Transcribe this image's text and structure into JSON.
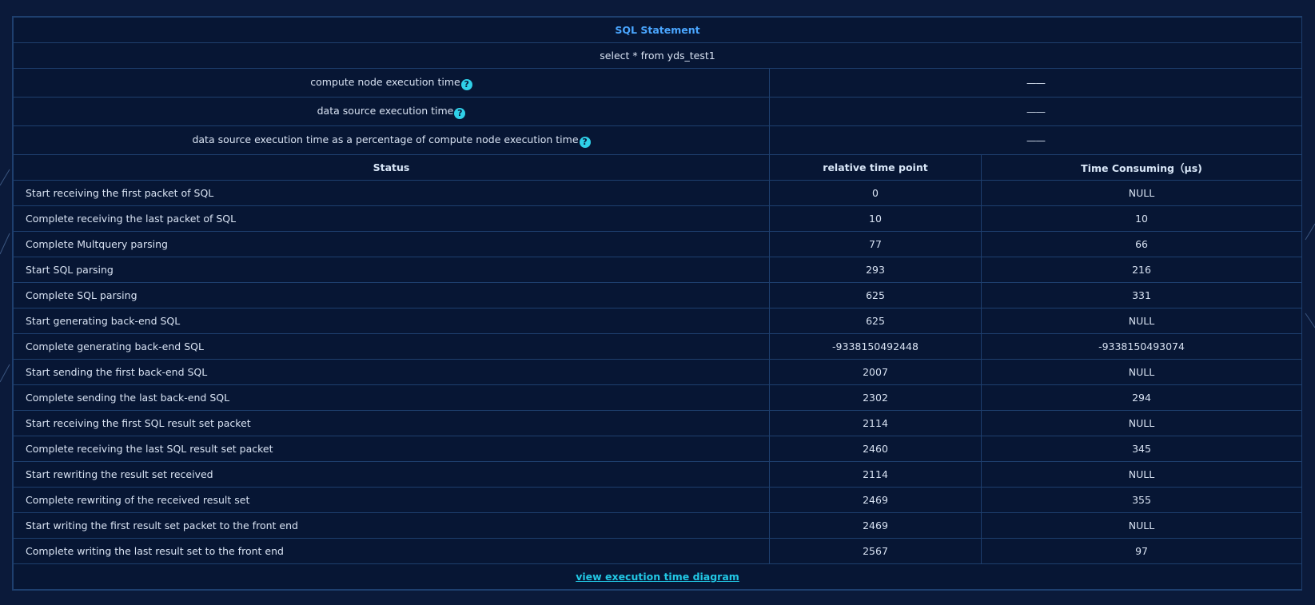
{
  "sql_statement_header": "SQL Statement",
  "sql_statement": "select * from yds_test1",
  "metrics": [
    {
      "label": "compute node execution time",
      "value": "——"
    },
    {
      "label": "data source execution time",
      "value": "——"
    },
    {
      "label": "data source execution time as a percentage of compute node execution time",
      "value": "——"
    }
  ],
  "columns": {
    "status": "Status",
    "relative_time_point": "relative time point",
    "time_consuming": "Time Consuming（μs)"
  },
  "rows": [
    {
      "status": "Start receiving the first packet of SQL",
      "time_point": "0",
      "consuming": "NULL"
    },
    {
      "status": "Complete receiving the last packet of SQL",
      "time_point": "10",
      "consuming": "10"
    },
    {
      "status": "Complete Multquery parsing",
      "time_point": "77",
      "consuming": "66"
    },
    {
      "status": "Start SQL parsing",
      "time_point": "293",
      "consuming": "216"
    },
    {
      "status": "Complete SQL parsing",
      "time_point": "625",
      "consuming": "331"
    },
    {
      "status": "Start generating back-end SQL",
      "time_point": "625",
      "consuming": "NULL"
    },
    {
      "status": "Complete generating back-end SQL",
      "time_point": "-9338150492448",
      "consuming": "-9338150493074"
    },
    {
      "status": "Start sending the first back-end SQL",
      "time_point": "2007",
      "consuming": "NULL"
    },
    {
      "status": "Complete sending the last back-end SQL",
      "time_point": "2302",
      "consuming": "294"
    },
    {
      "status": "Start receiving the first SQL result set packet",
      "time_point": "2114",
      "consuming": "NULL"
    },
    {
      "status": "Complete receiving the last SQL result set packet",
      "time_point": "2460",
      "consuming": "345"
    },
    {
      "status": "Start rewriting the result set received",
      "time_point": "2114",
      "consuming": "NULL"
    },
    {
      "status": "Complete rewriting of the received result set",
      "time_point": "2469",
      "consuming": "355"
    },
    {
      "status": "Start writing the first result set packet to the front end",
      "time_point": "2469",
      "consuming": "NULL"
    },
    {
      "status": "Complete writing the last result set to the front end",
      "time_point": "2567",
      "consuming": "97"
    }
  ],
  "footer_link": "view execution time diagram",
  "colors": {
    "background": "#0b1a3a",
    "panel": "#071634",
    "border": "#1e3f6e",
    "header_blue": "#4aa6ff",
    "link_cyan": "#22c8e5",
    "help_icon": "#2fd0e8"
  },
  "icons": {
    "help": "question-circle-icon"
  }
}
